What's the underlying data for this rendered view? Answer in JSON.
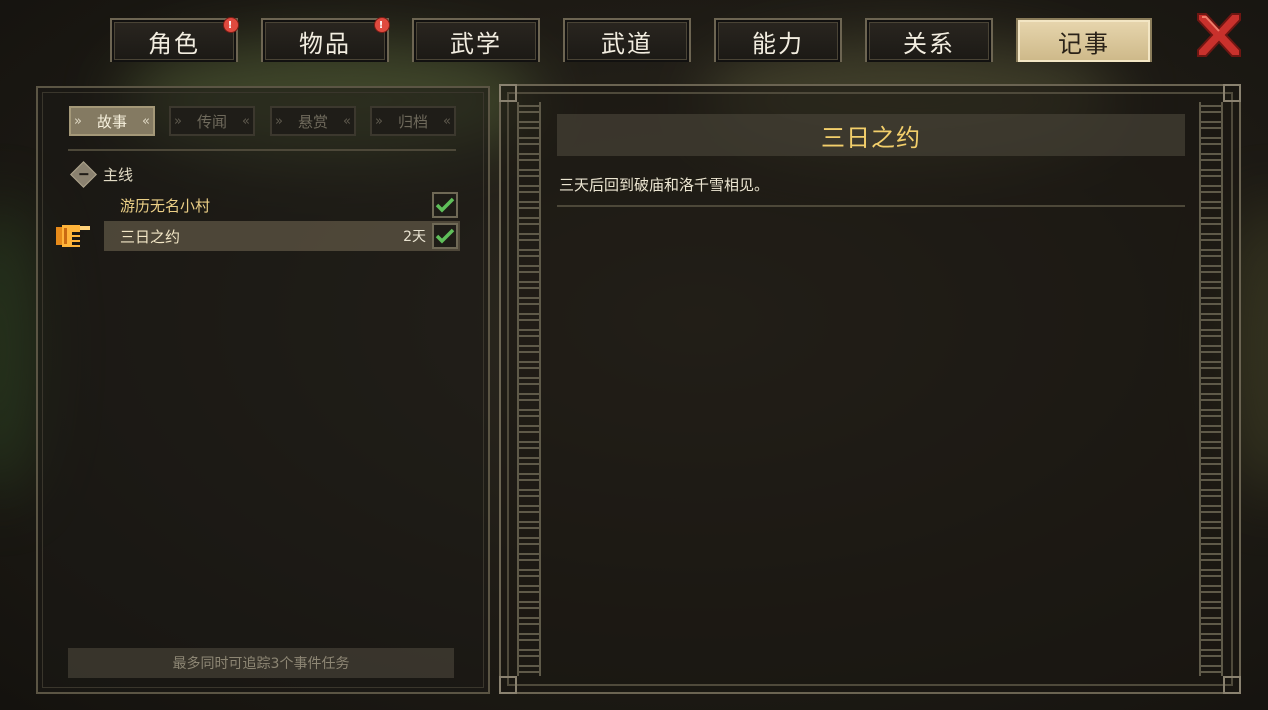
{
  "tabs": [
    {
      "label": "角色",
      "badge": "!"
    },
    {
      "label": "物品",
      "badge": "!"
    },
    {
      "label": "武学"
    },
    {
      "label": "武道"
    },
    {
      "label": "能力"
    },
    {
      "label": "关系"
    },
    {
      "label": "记事",
      "active": true
    }
  ],
  "close_icon": "close-x-icon",
  "journal": {
    "subtabs": [
      {
        "label": "故事",
        "active": true
      },
      {
        "label": "传闻"
      },
      {
        "label": "悬赏"
      },
      {
        "label": "归档"
      }
    ],
    "group": {
      "label": "主线",
      "icon": "collapse-diamond-icon"
    },
    "quests": [
      {
        "name": "游历无名小村",
        "days": "",
        "checked": true
      },
      {
        "name": "三日之约",
        "days": "2天",
        "checked": true,
        "selected": true
      }
    ],
    "pointer_icon": "pointing-hand-icon",
    "footer_note": "最多同时可追踪3个事件任务"
  },
  "detail": {
    "title": "三日之约",
    "description": "三天后回到破庙和洛千雪相见。"
  },
  "colors": {
    "title_gold": "#f3cf6b",
    "active_tab": "#e0cfa4",
    "badge_red": "#e04a3f",
    "check_green": "#5fbf5a",
    "close_red": "#c9312c"
  }
}
